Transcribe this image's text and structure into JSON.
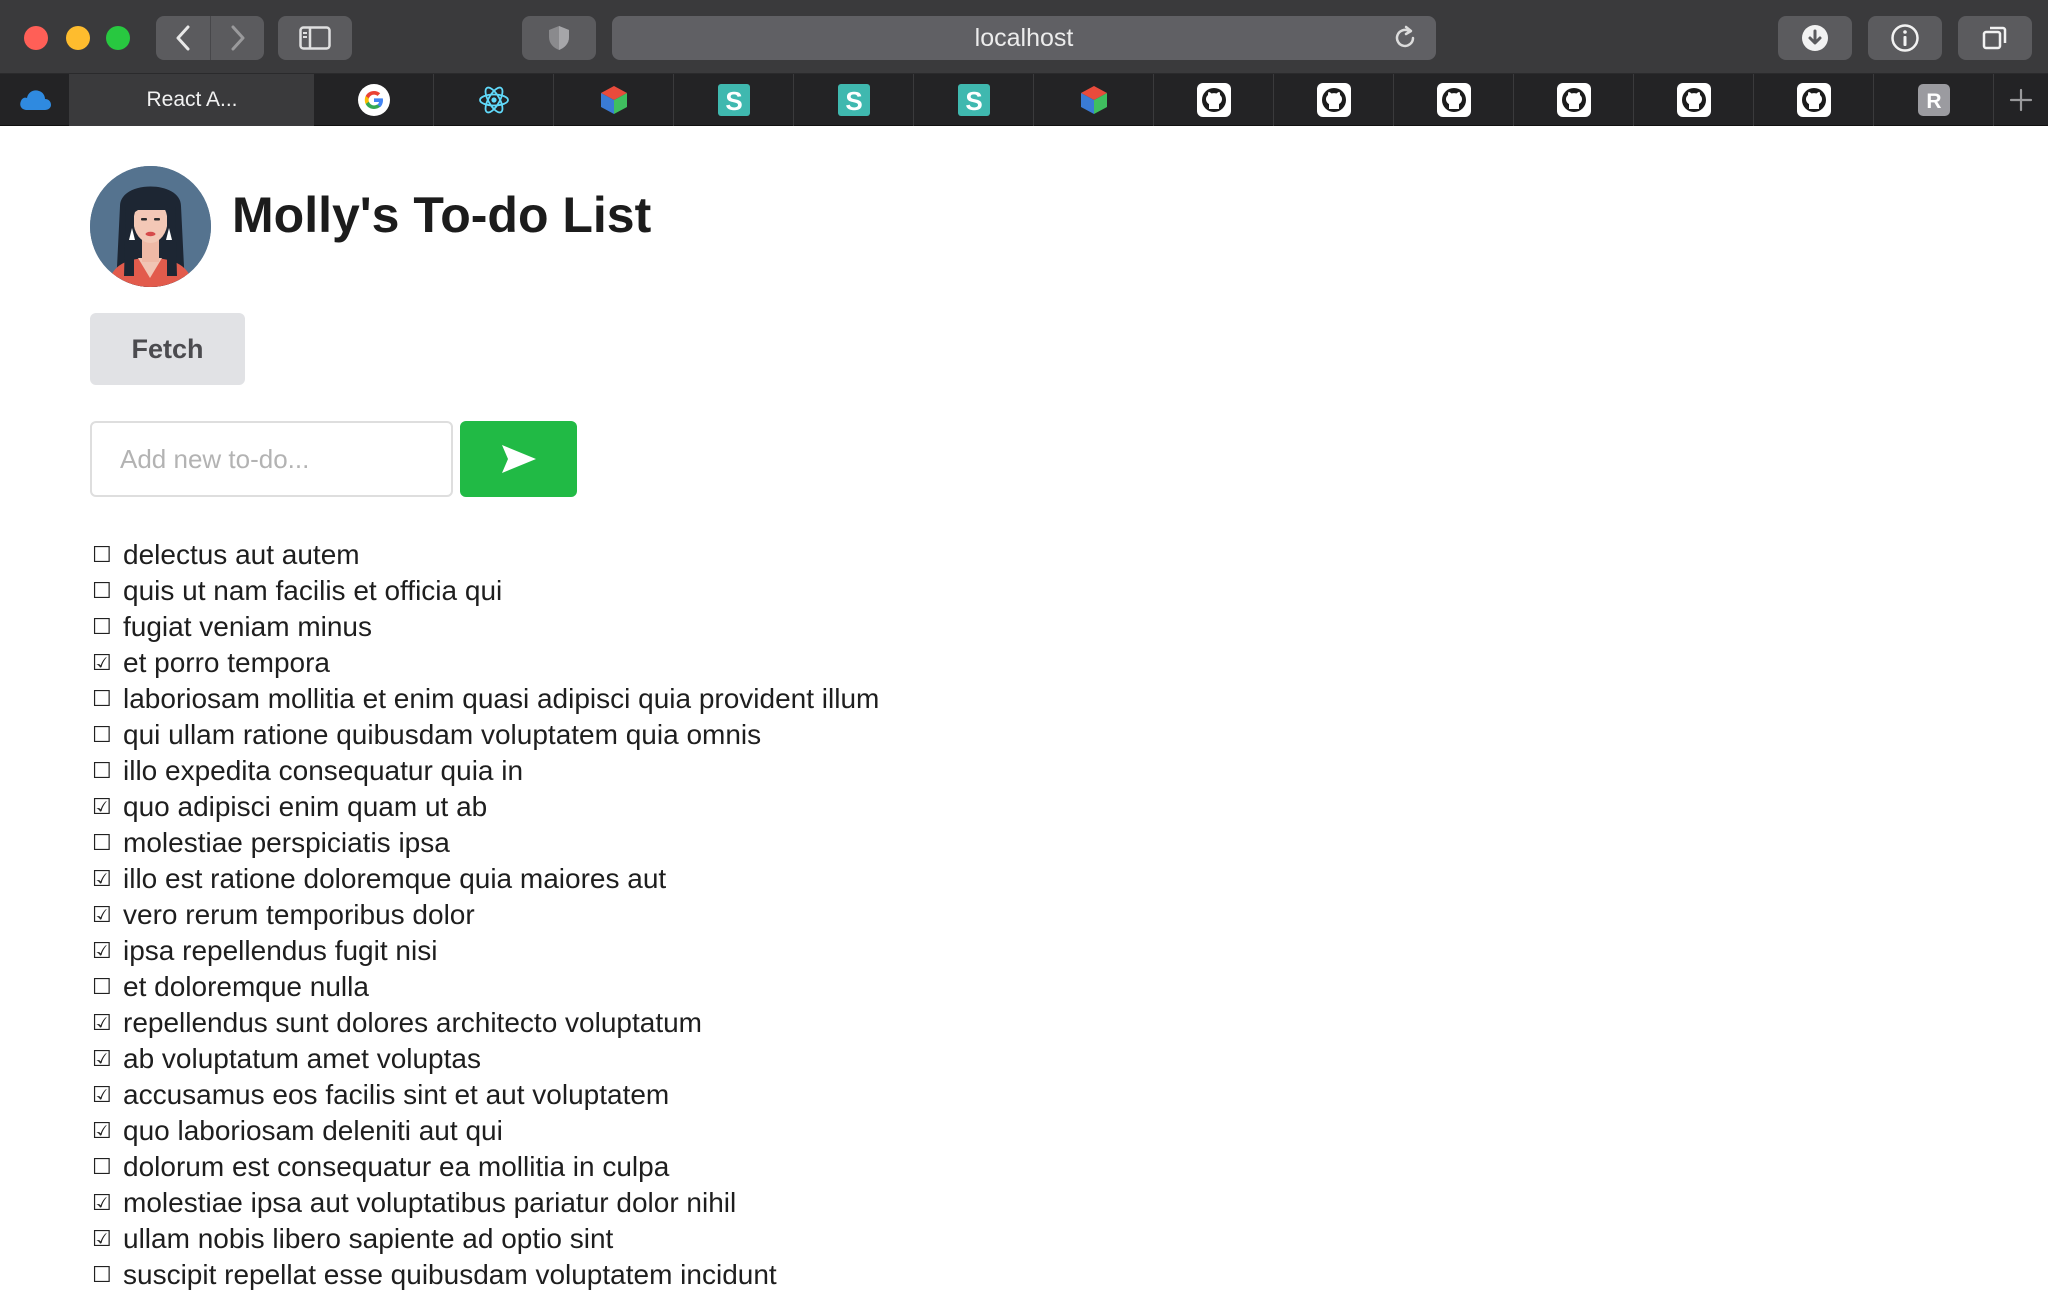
{
  "browser": {
    "url": "localhost",
    "active_tab_title": "React A...",
    "favorites": [
      {
        "icon": "google-icon"
      },
      {
        "icon": "react-icon"
      },
      {
        "icon": "codesandbox-icon"
      },
      {
        "icon": "stackblitz-s-icon"
      },
      {
        "icon": "stackblitz-s-icon"
      },
      {
        "icon": "stackblitz-s-icon"
      },
      {
        "icon": "codesandbox-icon"
      },
      {
        "icon": "github-icon"
      },
      {
        "icon": "github-icon"
      },
      {
        "icon": "github-icon"
      },
      {
        "icon": "github-icon"
      },
      {
        "icon": "github-icon"
      },
      {
        "icon": "github-icon"
      },
      {
        "icon": "r-letter-icon",
        "letter": "R"
      }
    ]
  },
  "page": {
    "title": "Molly's To-do List",
    "fetch_label": "Fetch",
    "input_placeholder": "Add new to-do...",
    "todos": [
      {
        "text": "delectus aut autem",
        "done": false
      },
      {
        "text": "quis ut nam facilis et officia qui",
        "done": false
      },
      {
        "text": "fugiat veniam minus",
        "done": false
      },
      {
        "text": "et porro tempora",
        "done": true
      },
      {
        "text": "laboriosam mollitia et enim quasi adipisci quia provident illum",
        "done": false
      },
      {
        "text": "qui ullam ratione quibusdam voluptatem quia omnis",
        "done": false
      },
      {
        "text": "illo expedita consequatur quia in",
        "done": false
      },
      {
        "text": "quo adipisci enim quam ut ab",
        "done": true
      },
      {
        "text": "molestiae perspiciatis ipsa",
        "done": false
      },
      {
        "text": "illo est ratione doloremque quia maiores aut",
        "done": true
      },
      {
        "text": "vero rerum temporibus dolor",
        "done": true
      },
      {
        "text": "ipsa repellendus fugit nisi",
        "done": true
      },
      {
        "text": "et doloremque nulla",
        "done": false
      },
      {
        "text": "repellendus sunt dolores architecto voluptatum",
        "done": true
      },
      {
        "text": "ab voluptatum amet voluptas",
        "done": true
      },
      {
        "text": "accusamus eos facilis sint et aut voluptatem",
        "done": true
      },
      {
        "text": "quo laboriosam deleniti aut qui",
        "done": true
      },
      {
        "text": "dolorum est consequatur ea mollitia in culpa",
        "done": false
      },
      {
        "text": "molestiae ipsa aut voluptatibus pariatur dolor nihil",
        "done": true
      },
      {
        "text": "ullam nobis libero sapiente ad optio sint",
        "done": true
      },
      {
        "text": "suscipit repellat esse quibusdam voluptatem incidunt",
        "done": false
      }
    ]
  },
  "colors": {
    "send_button": "#21ba45",
    "fetch_button": "#e1e2e5"
  }
}
